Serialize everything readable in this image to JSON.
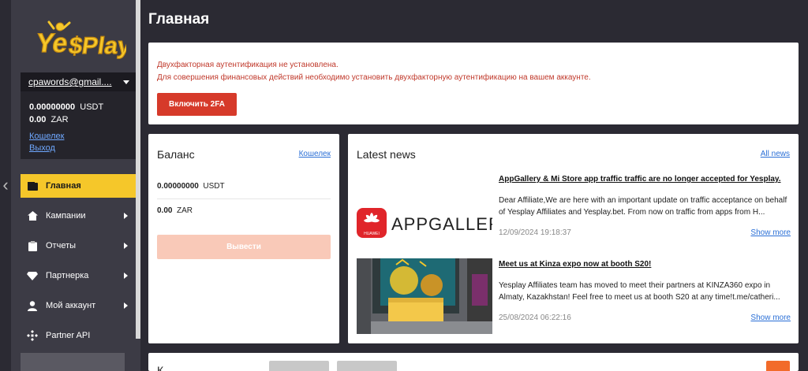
{
  "brand": {
    "logo_text_a": "Ye",
    "logo_text_b": "$Play"
  },
  "account": {
    "email": "cpawords@gmail....",
    "balances": [
      {
        "amount": "0.00000000",
        "currency": "USDT"
      },
      {
        "amount": "0.00",
        "currency": "ZAR"
      }
    ],
    "links": {
      "wallet": "Кошелек",
      "logout": "Выход"
    }
  },
  "menu": [
    {
      "label": "Главная",
      "icon": "wallet-icon",
      "active": true,
      "has_arrow": false
    },
    {
      "label": "Кампании",
      "icon": "home-icon",
      "active": false,
      "has_arrow": true
    },
    {
      "label": "Отчеты",
      "icon": "clipboard-icon",
      "active": false,
      "has_arrow": true
    },
    {
      "label": "Партнерка",
      "icon": "diamond-icon",
      "active": false,
      "has_arrow": true
    },
    {
      "label": "Мой аккаунт",
      "icon": "user-icon",
      "active": false,
      "has_arrow": true
    },
    {
      "label": "Partner API",
      "icon": "api-icon",
      "active": false,
      "has_arrow": false
    }
  ],
  "page": {
    "title": "Главная"
  },
  "alert": {
    "line1": "Двухфакторная аутентификация не установлена.",
    "line2": "Для совершения финансовых действий необходимо установить двухфакторную аутентификацию на вашем аккаунте.",
    "button": "Включить 2FA"
  },
  "balance_card": {
    "title": "Баланс",
    "link": "Кошелек",
    "rows": [
      {
        "amount": "0.00000000",
        "currency": "USDT"
      },
      {
        "amount": "0.00",
        "currency": "ZAR"
      }
    ],
    "withdraw": "Вывести"
  },
  "news_card": {
    "title": "Latest news",
    "link": "All news",
    "items": [
      {
        "headline": "AppGallery & Mi Store app traffic traffic are no longer accepted for Yesplay.",
        "body": "Dear Affiliate,We are here with an important update on traffic acceptance on behalf of Yesplay Affiliates and Yesplay.bet. From now on traffic from apps from H...",
        "date": "12/09/2024 19:18:37",
        "more": "Show more",
        "image_text": "APPGALLERY",
        "image_badge": "HUAWEI"
      },
      {
        "headline": "Meet us at Kinza expo now at booth S20!",
        "body": "Yesplay Affiliates team has moved to meet their partners at KINZA360 expo in Almaty, Kazakhstan! Feel free to meet us at booth S20 at any time!t.me/catheri...",
        "date": "25/08/2024 06:22:16",
        "more": "Show more"
      }
    ]
  },
  "bottom": {
    "title_start": "К"
  },
  "colors": {
    "accent_yellow": "#f5c72a",
    "danger_red": "#d63a2a",
    "link_blue": "#2a6fd6",
    "sidebar_bg": "#3c3b45",
    "page_bg": "#2b2a33"
  }
}
